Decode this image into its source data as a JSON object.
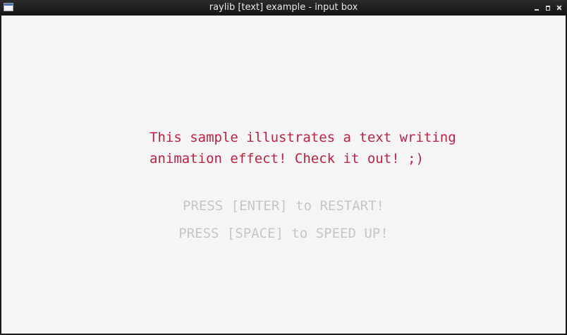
{
  "window": {
    "title": "raylib [text] example - input box"
  },
  "icons": {
    "app": "app-window-icon",
    "minimize": "minimize-icon",
    "maximize": "maximize-icon",
    "close": "close-icon"
  },
  "canvas": {
    "background": "#f5f5f5",
    "message": {
      "lines": [
        "This sample illustrates a text writing",
        "animation effect! Check it out! ;)"
      ],
      "color": "#be2142"
    },
    "hints": {
      "restart": "PRESS [ENTER] to RESTART!",
      "speed_up": "PRESS [SPACE] to SPEED UP!",
      "color": "#c6c6c6"
    }
  }
}
